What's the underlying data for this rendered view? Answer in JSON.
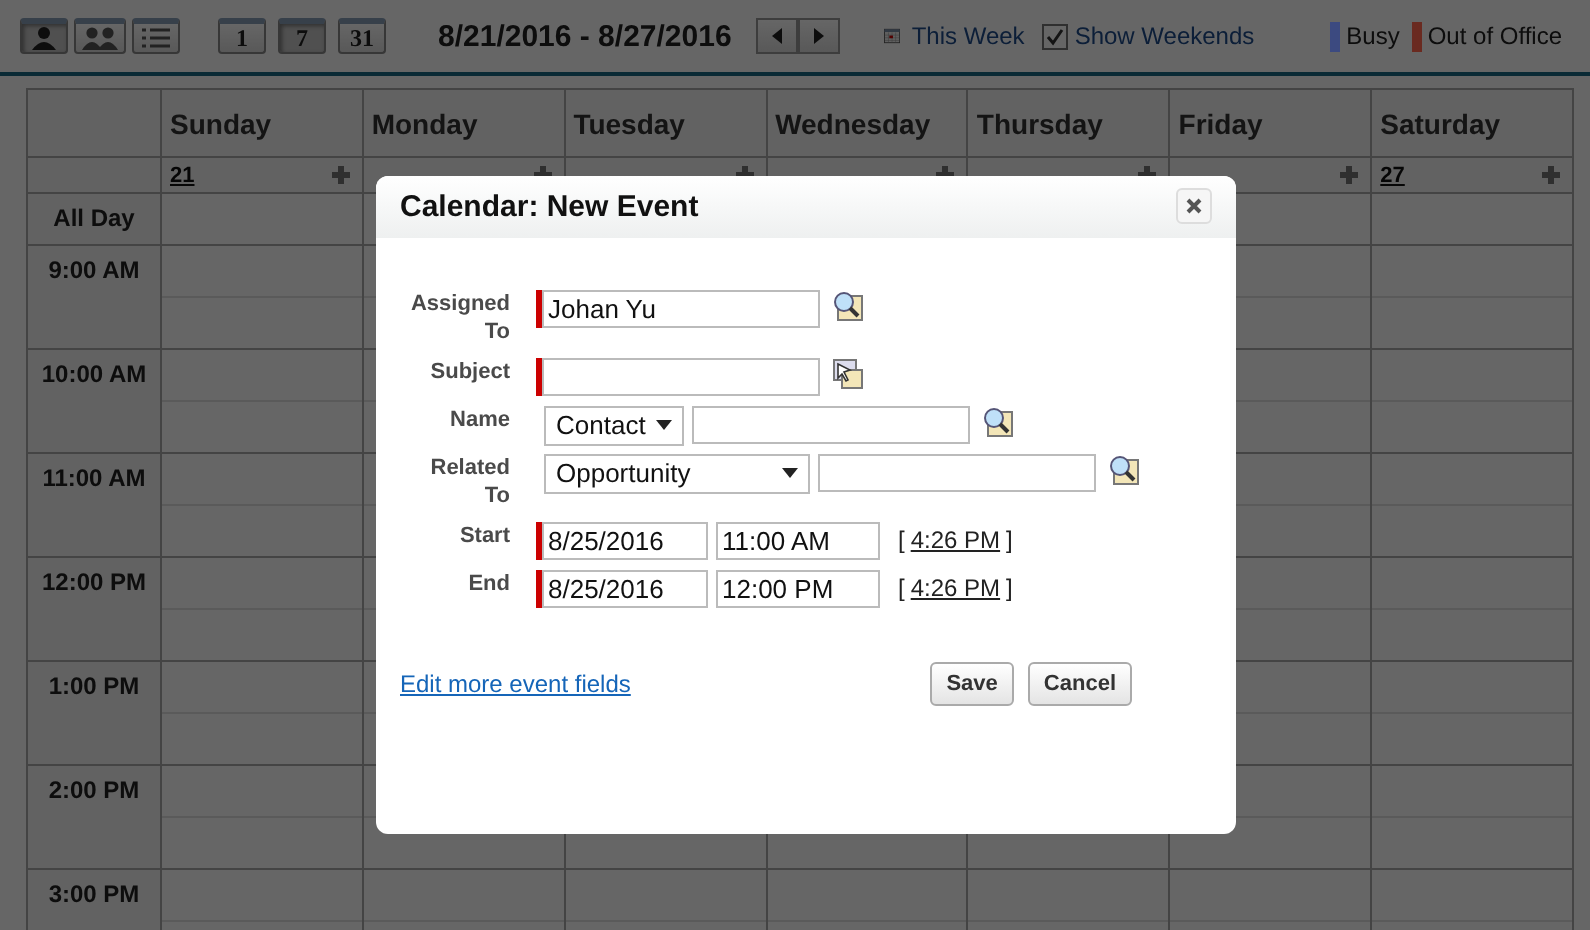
{
  "toolbar": {
    "view_buttons": [
      {
        "kind": "single-user",
        "selected": true
      },
      {
        "kind": "multi-user",
        "selected": false
      },
      {
        "kind": "list",
        "selected": false
      }
    ],
    "range_buttons": [
      {
        "label": "1",
        "selected": false
      },
      {
        "label": "7",
        "selected": true
      },
      {
        "label": "31",
        "selected": false
      }
    ],
    "date_range": "8/21/2016 - 8/27/2016",
    "this_week": "This Week",
    "show_weekends": {
      "label": "Show Weekends",
      "checked": true
    },
    "legend": [
      {
        "label": "Busy",
        "color": "#3c4a80"
      },
      {
        "label": "Out of Office",
        "color": "#6a2a20"
      }
    ]
  },
  "calendar": {
    "days": [
      {
        "name": "Sunday",
        "date": "21"
      },
      {
        "name": "Monday"
      },
      {
        "name": "Tuesday"
      },
      {
        "name": "Wednesday"
      },
      {
        "name": "Thursday"
      },
      {
        "name": "Friday"
      },
      {
        "name": "Saturday",
        "date": "27"
      }
    ],
    "all_day": "All Day",
    "hours": [
      "9:00 AM",
      "10:00 AM",
      "11:00 AM",
      "12:00 PM",
      "1:00 PM",
      "2:00 PM",
      "3:00 PM"
    ]
  },
  "dialog": {
    "title": "Calendar: New Event",
    "fields": [
      {
        "kind": "lookup",
        "label": "Assigned To",
        "value": "Johan Yu",
        "required": true
      },
      {
        "kind": "picker",
        "label": "Subject",
        "required": true
      },
      {
        "kind": "typed-lookup",
        "label": "Name",
        "type": "Contact"
      },
      {
        "kind": "typed-lookup",
        "label": "Related To",
        "type": "Opportunity"
      },
      {
        "kind": "datetime",
        "label": "Start",
        "date": "8/25/2016",
        "time": "11:00 AM",
        "bracket_open": "[",
        "now": "4:26 PM",
        "bracket_close": "]",
        "required": true
      },
      {
        "kind": "datetime",
        "label": "End",
        "date": "8/25/2016",
        "time": "12:00 PM",
        "bracket_open": "[",
        "now": "4:26 PM",
        "bracket_close": "]",
        "required": true
      }
    ],
    "more_link": "Edit more event fields",
    "buttons": [
      "Save",
      "Cancel"
    ]
  }
}
